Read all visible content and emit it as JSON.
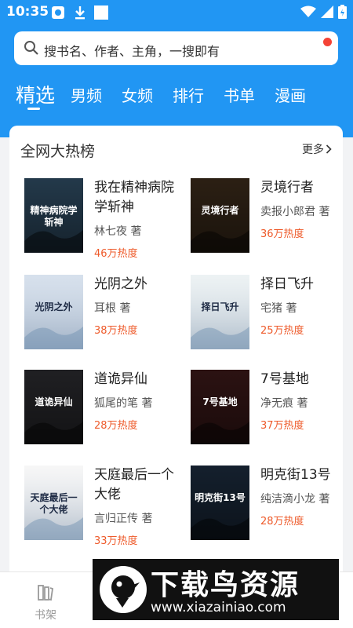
{
  "status_bar": {
    "time": "10:35"
  },
  "search": {
    "placeholder": "搜书名、作者、主角，一搜即有"
  },
  "tabs": [
    {
      "label": "精选",
      "active": true
    },
    {
      "label": "男频"
    },
    {
      "label": "女频"
    },
    {
      "label": "排行"
    },
    {
      "label": "书单"
    },
    {
      "label": "漫画"
    }
  ],
  "section": {
    "title": "全网大热榜",
    "more_label": "更多"
  },
  "books": [
    {
      "title": "我在精神病院学斩神",
      "author": "林七夜 著",
      "heat": "46万热度",
      "cover_text": "精神病院学斩神",
      "cover_bg": "#2f4c63"
    },
    {
      "title": "灵境行者",
      "author": "卖报小郎君 著",
      "heat": "36万热度",
      "cover_text": "灵境行者",
      "cover_bg": "#3a2a1a"
    },
    {
      "title": "光阴之外",
      "author": "耳根 著",
      "heat": "38万热度",
      "cover_text": "光阴之外",
      "cover_bg": "#c9d6e6"
    },
    {
      "title": "择日飞升",
      "author": "宅猪 著",
      "heat": "25万热度",
      "cover_text": "择日飞升",
      "cover_bg": "#e7eef0"
    },
    {
      "title": "道诡异仙",
      "author": "狐尾的笔 著",
      "heat": "28万热度",
      "cover_text": "道诡异仙",
      "cover_bg": "#2a2a2e"
    },
    {
      "title": "7号基地",
      "author": "净无痕 著",
      "heat": "37万热度",
      "cover_text": "7号基地",
      "cover_bg": "#3a1818"
    },
    {
      "title": "天庭最后一个大佬",
      "author": "言归正传 著",
      "heat": "33万热度",
      "cover_text": "天庭最后一个大佬",
      "cover_bg": "#f4f4f4"
    },
    {
      "title": "明克街13号",
      "author": "纯洁滴小龙 著",
      "heat": "28万热度",
      "cover_text": "明克街13号",
      "cover_bg": "#1b2a3c"
    }
  ],
  "bottom_nav": {
    "shelf_label": "书架"
  },
  "watermark": {
    "title": "下载鸟资源",
    "url": "www.xiazainiao.com"
  },
  "colors": {
    "primary": "#2196f3",
    "heat": "#ee5a2a",
    "badge": "#f44336"
  }
}
